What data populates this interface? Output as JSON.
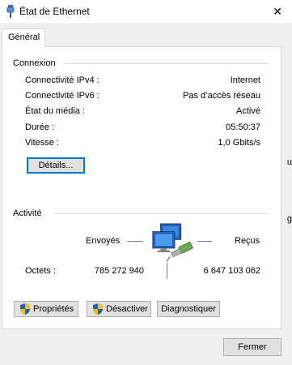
{
  "window": {
    "title": "État de Ethernet",
    "close_glyph": "✕"
  },
  "tabs": [
    {
      "label": "Général",
      "selected": true
    }
  ],
  "connection": {
    "group_label": "Connexion",
    "rows": [
      {
        "label": "Connectivité IPv4 :",
        "value": "Internet"
      },
      {
        "label": "Connectivité IPv6 :",
        "value": "Pas d’accès réseau"
      },
      {
        "label": "État du média :",
        "value": "Activé"
      },
      {
        "label": "Durée :",
        "value": "05:50:37"
      },
      {
        "label": "Vitesse :",
        "value": "1,0 Gbits/s"
      }
    ],
    "details_button": "Détails..."
  },
  "activity": {
    "group_label": "Activité",
    "sent_label": "Envoyés",
    "received_label": "Reçus",
    "bytes_label": "Octets :",
    "bytes_sent": "785 272 940",
    "bytes_received": "6 647 103 062"
  },
  "buttons": {
    "properties": "Propriétés",
    "disable": "Désactiver",
    "diagnose": "Diagnostiquer",
    "close": "Fermer"
  },
  "edge_fragments": [
    "u",
    "g"
  ],
  "colors": {
    "accent": "#0078d7",
    "shield_blue": "#1f5fb8",
    "shield_yellow": "#f2c01e"
  }
}
